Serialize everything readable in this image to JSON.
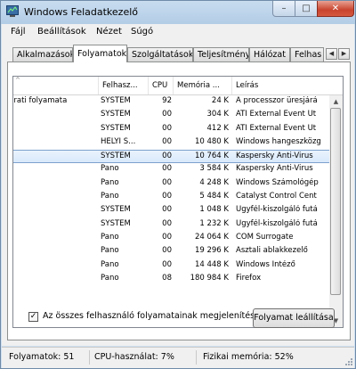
{
  "window": {
    "title": "Windows Feladatkezelő",
    "minimize": "–",
    "maximize": "□",
    "close": "✕"
  },
  "menu": [
    "Fájl",
    "Beállítások",
    "Nézet",
    "Súgó"
  ],
  "tabs": [
    "Alkalmazások",
    "Folyamatok",
    "Szolgáltatások",
    "Teljesítmény",
    "Hálózat",
    "Felhas"
  ],
  "active_tab": "Folyamatok",
  "tab_arrows": {
    "left": "◀",
    "right": "▶"
  },
  "table": {
    "columns": [
      "",
      "Felhasz...",
      "CPU",
      "Memória ...",
      "Leírás"
    ],
    "sort_indicator": "^",
    "rows": [
      {
        "image": "irati folyamata",
        "user": "SYSTEM",
        "cpu": "92",
        "mem": "24 K",
        "desc": "A processzor üresjárá"
      },
      {
        "image": "",
        "user": "SYSTEM",
        "cpu": "00",
        "mem": "304 K",
        "desc": "ATI External Event Ut"
      },
      {
        "image": "",
        "user": "SYSTEM",
        "cpu": "00",
        "mem": "412 K",
        "desc": "ATI External Event Ut"
      },
      {
        "image": "",
        "user": "HELYI S...",
        "cpu": "00",
        "mem": "10 480 K",
        "desc": "Windows hangeszközg"
      },
      {
        "image": "",
        "user": "SYSTEM",
        "cpu": "00",
        "mem": "10 764 K",
        "desc": "Kaspersky Anti-Virus"
      },
      {
        "image": "",
        "user": "Pano",
        "cpu": "00",
        "mem": "3 584 K",
        "desc": "Kaspersky Anti-Virus"
      },
      {
        "image": "",
        "user": "Pano",
        "cpu": "00",
        "mem": "4 248 K",
        "desc": "Windows Számológép"
      },
      {
        "image": "",
        "user": "Pano",
        "cpu": "00",
        "mem": "5 484 K",
        "desc": "Catalyst Control Cent"
      },
      {
        "image": "",
        "user": "SYSTEM",
        "cpu": "00",
        "mem": "1 048 K",
        "desc": "Ügyfél-kiszolgáló futá"
      },
      {
        "image": "",
        "user": "SYSTEM",
        "cpu": "00",
        "mem": "1 232 K",
        "desc": "Ügyfél-kiszolgáló futá"
      },
      {
        "image": "",
        "user": "Pano",
        "cpu": "00",
        "mem": "24 064 K",
        "desc": "COM Surrogate"
      },
      {
        "image": "",
        "user": "Pano",
        "cpu": "00",
        "mem": "19 296 K",
        "desc": "Asztali ablakkezelő"
      },
      {
        "image": "",
        "user": "Pano",
        "cpu": "00",
        "mem": "14 448 K",
        "desc": "Windows Intéző"
      },
      {
        "image": "",
        "user": "Pano",
        "cpu": "08",
        "mem": "180 984 K",
        "desc": "Firefox"
      }
    ],
    "selected_row": 4
  },
  "scrollbar": {
    "up": "▲",
    "down": "▼"
  },
  "show_all_checkbox": {
    "label": "Az összes felhasználó folyamatainak megjelenítése",
    "checked": true,
    "mark": "✓"
  },
  "end_process_button": "Folyamat leállítása",
  "status": {
    "processes": "Folyamatok: 51",
    "cpu": "CPU-használat: 7%",
    "memory": "Fizikai memória: 52%"
  },
  "colors": {
    "accent": "#7da2ce",
    "close_button": "#c9442e",
    "selection": "#d9e9fb"
  }
}
